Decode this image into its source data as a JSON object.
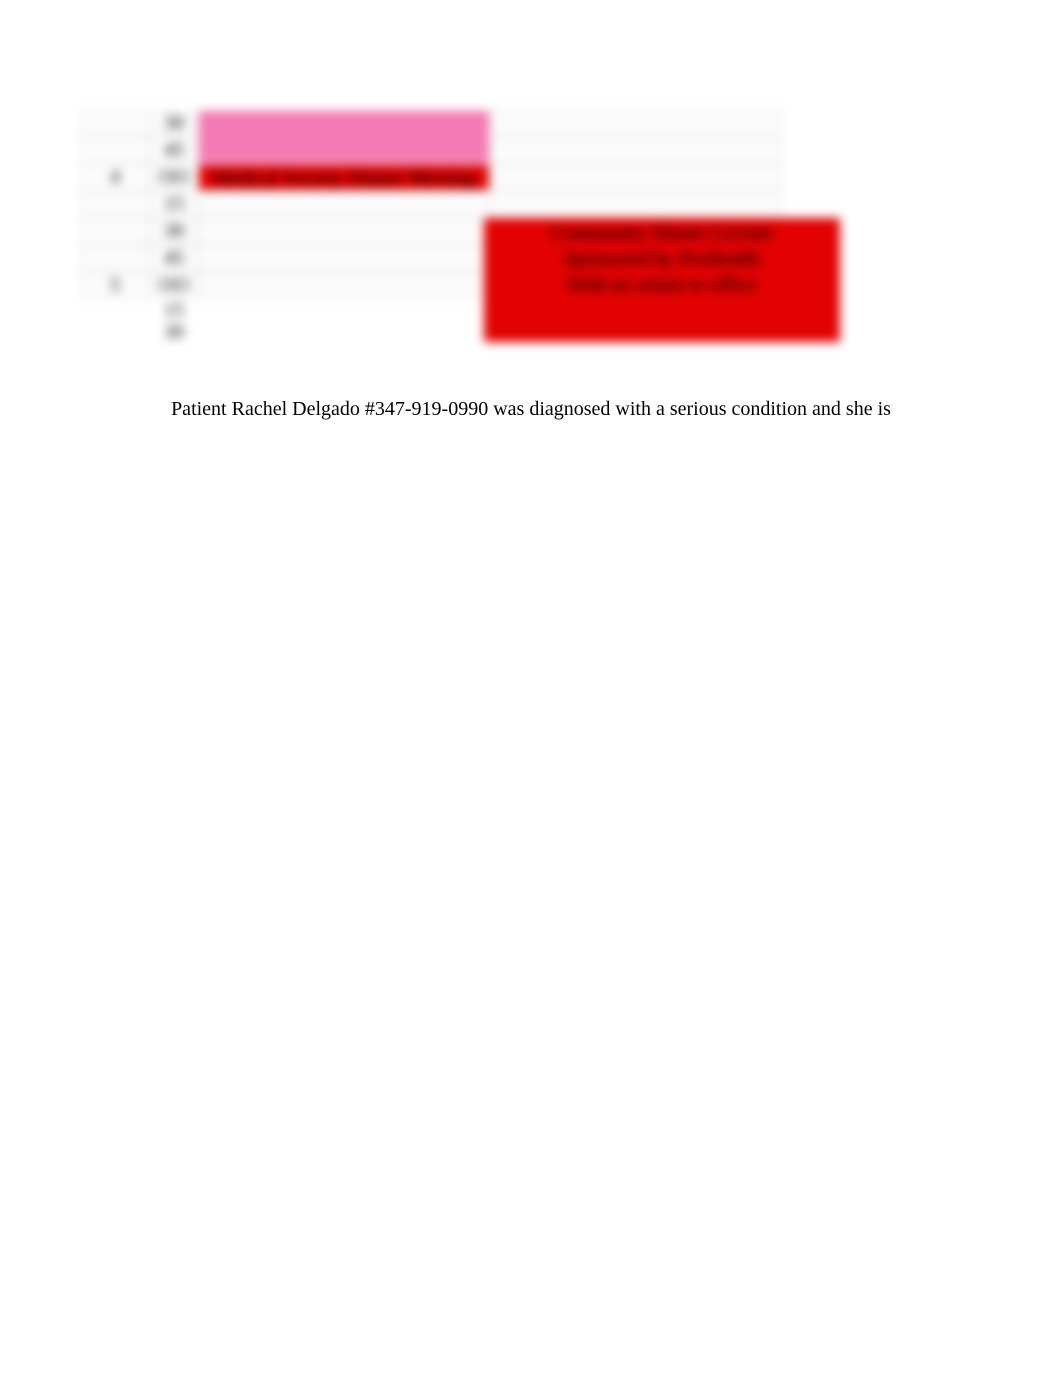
{
  "schedule": {
    "rows": [
      {
        "hour": "",
        "min": "30"
      },
      {
        "hour": "",
        "min": "45"
      },
      {
        "hour": "4",
        "min": "OO"
      },
      {
        "hour": "",
        "min": "15"
      },
      {
        "hour": "",
        "min": "30"
      },
      {
        "hour": "",
        "min": "45"
      },
      {
        "hour": "5",
        "min": "OO"
      },
      {
        "hour": "",
        "min": "15"
      },
      {
        "hour": "",
        "min": "30"
      }
    ],
    "events": {
      "pink_block": {
        "label": ""
      },
      "medical_society": {
        "label": "Medical Society Dinner Meeting"
      },
      "community_lecture": {
        "line1": "Community Dinner Lecture",
        "line2": "Sponsored by ProHealth",
        "line3": "With no return to office"
      }
    }
  },
  "paragraph": "Patient Rachel Delgado #347-919-0990 was diagnosed with a serious condition and she is"
}
